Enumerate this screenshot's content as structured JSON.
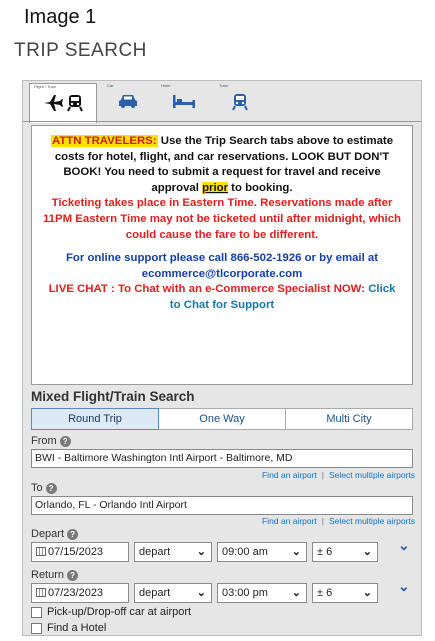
{
  "caption": "Image 1",
  "page_title": "TRIP SEARCH",
  "tabs": [
    {
      "label": "Flight / Train",
      "icons": [
        "plane-icon",
        "train-icon"
      ],
      "active": true
    },
    {
      "label": "Car",
      "icons": [
        "car-icon"
      ],
      "active": false
    },
    {
      "label": "Hotel",
      "icons": [
        "bed-icon"
      ],
      "active": false
    },
    {
      "label": "Train",
      "icons": [
        "train-icon"
      ],
      "active": false
    }
  ],
  "notice": {
    "attn": "ATTN TRAVELERS:",
    "line1": " Use the Trip Search tabs above to estimate costs for hotel, flight, and car reservations. LOOK BUT DON'T BOOK! You need to submit a request for travel and receive approval ",
    "prior": "prior",
    "line1_end": " to booking.",
    "red1": "Ticketing takes place in Eastern Time. Reservations made after 11PM Eastern Time may not be ticketed until after midnight, which could cause the fare to be different.",
    "support": "For online support please call 866-502-1926 or by email at ecommerce@tlcorporate.com",
    "live_chat": "LIVE CHAT : To Chat with an e-Commerce Specialist NOW: ",
    "chat_link": "Click to Chat for Support"
  },
  "search": {
    "title": "Mixed Flight/Train Search",
    "trip_types": [
      "Round Trip",
      "One Way",
      "Multi City"
    ],
    "selected_trip_type": "Round Trip",
    "from_label": "From",
    "from_value": "BWI - Baltimore Washington Intl Airport - Baltimore, MD",
    "to_label": "To",
    "to_value": "Orlando, FL - Orlando Intl Airport",
    "find_airport": "Find an airport",
    "select_multiple": "Select multiple airports",
    "link_sep": "|",
    "depart": {
      "label": "Depart",
      "date": "07/15/2023",
      "mode": "depart",
      "time": "09:00 am",
      "window": "± 6"
    },
    "return": {
      "label": "Return",
      "date": "07/23/2023",
      "mode": "depart",
      "time": "03:00 pm",
      "window": "± 6"
    },
    "checkboxes": [
      "Pick-up/Drop-off car at airport",
      "Find a Hotel"
    ]
  },
  "colors": {
    "attn_bg": "#ffe000",
    "red_text": "#e01e1e",
    "blue_text": "#1340a8",
    "link": "#1a6fb8"
  }
}
